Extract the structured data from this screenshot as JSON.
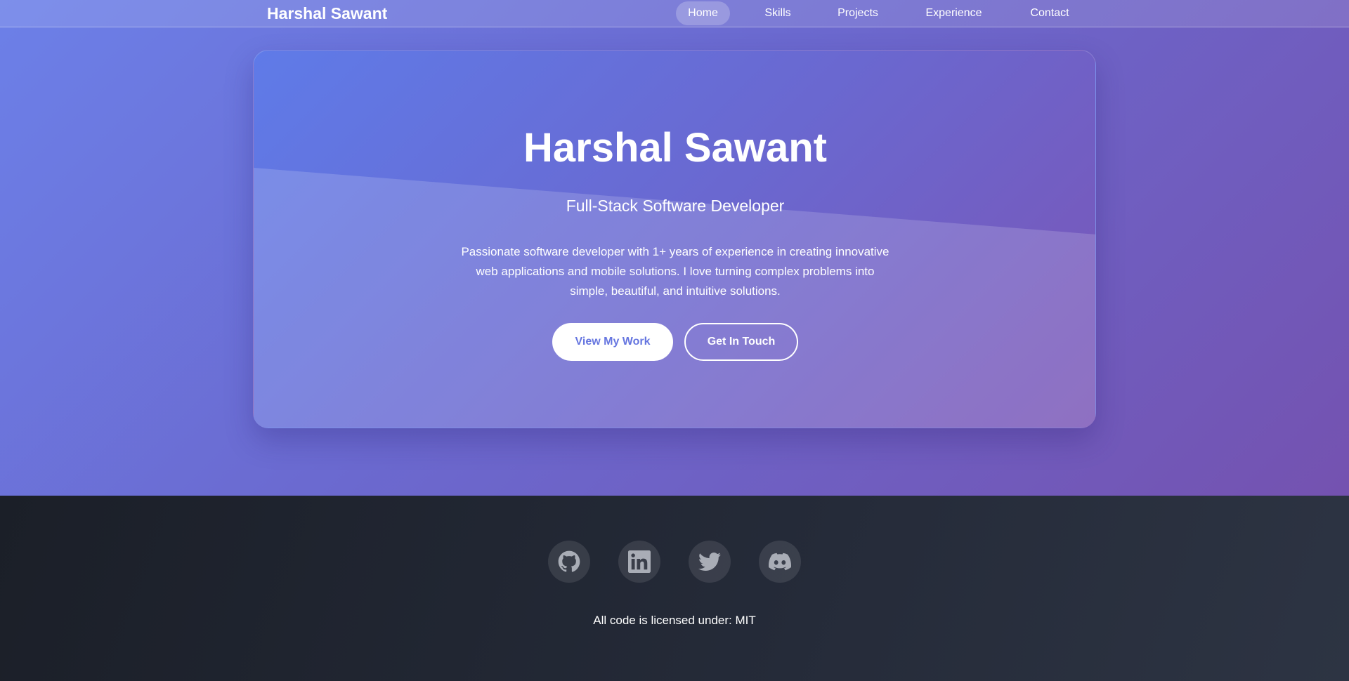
{
  "navbar": {
    "brand": "Harshal Sawant",
    "links": [
      {
        "label": "Home",
        "active": true
      },
      {
        "label": "Skills",
        "active": false
      },
      {
        "label": "Projects",
        "active": false
      },
      {
        "label": "Experience",
        "active": false
      },
      {
        "label": "Contact",
        "active": false
      }
    ]
  },
  "hero": {
    "title": "Harshal Sawant",
    "subtitle": "Full-Stack Software Developer",
    "description": "Passionate software developer with 1+ years of experience in creating innovative web applications and mobile solutions. I love turning complex problems into simple, beautiful, and intuitive solutions.",
    "primary_button": "View My Work",
    "secondary_button": "Get In Touch"
  },
  "footer": {
    "social": [
      {
        "icon": "github-icon"
      },
      {
        "icon": "linkedin-icon"
      },
      {
        "icon": "twitter-icon"
      },
      {
        "icon": "discord-icon"
      }
    ],
    "license": "All code is licensed under: MIT"
  },
  "colors": {
    "hero_gradient_start": "#6c80e8",
    "hero_gradient_end": "#7452b0",
    "button_text_accent": "#6676e0",
    "footer_bg": "#1f232c"
  }
}
